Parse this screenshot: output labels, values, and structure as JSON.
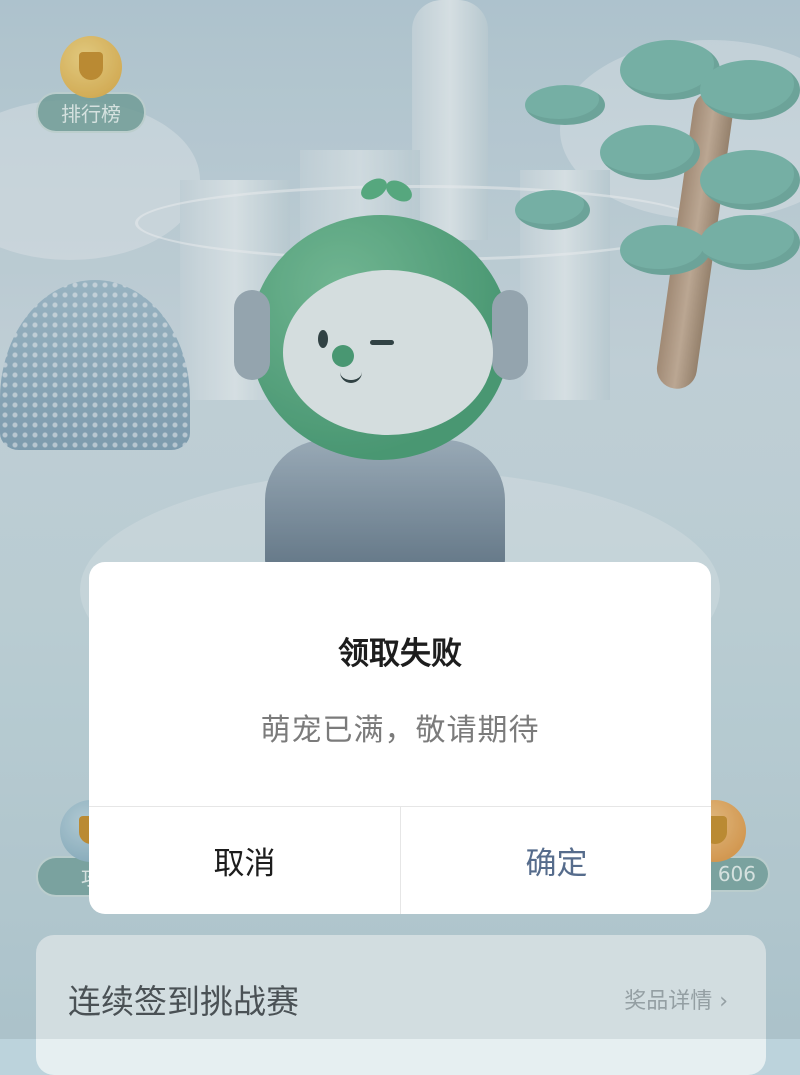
{
  "leaderboard": {
    "label": "排行榜"
  },
  "strategy": {
    "label": "攻"
  },
  "coins": {
    "count": "606"
  },
  "challenge": {
    "title": "连续签到挑战赛",
    "prize_link": "奖品详情 ›"
  },
  "dialog": {
    "title": "领取失败",
    "message": "萌宠已满，敬请期待",
    "cancel_label": "取消",
    "confirm_label": "确定"
  },
  "colors": {
    "confirm_text": "#566c8c",
    "dialog_bg": "#ffffff"
  }
}
